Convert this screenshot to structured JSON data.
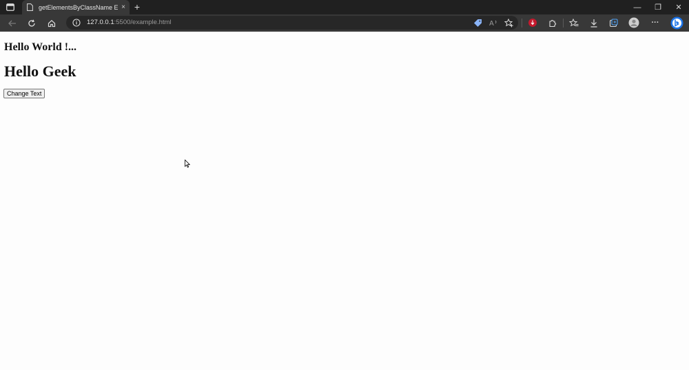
{
  "browser": {
    "tab": {
      "title": "getElementsByClassName Examp",
      "close_glyph": "×"
    },
    "newtab_glyph": "+",
    "window_controls": {
      "minimize": "—",
      "restore": "❐",
      "close": "✕"
    },
    "address": {
      "host": "127.0.0.1",
      "rest": ":5500/example.html"
    },
    "more_glyph": "···"
  },
  "page": {
    "heading_small": "Hello World !...",
    "heading_large": "Hello Geek",
    "button_label": "Change Text"
  },
  "colors": {
    "titlebar": "#202020",
    "toolbar": "#383838",
    "page_bg": "#fdfdfd",
    "accent_blue": "#1a73e8"
  },
  "icons": [
    "tab-actions-icon",
    "page-icon",
    "back-icon",
    "refresh-icon",
    "home-icon",
    "info-icon",
    "coupon-icon",
    "read-aloud-icon",
    "add-favorite-icon",
    "extension-red-icon",
    "extensions-icon",
    "favorites-icon",
    "downloads-icon",
    "collections-icon",
    "profile-icon",
    "more-icon",
    "copilot-icon",
    "cursor-icon"
  ]
}
